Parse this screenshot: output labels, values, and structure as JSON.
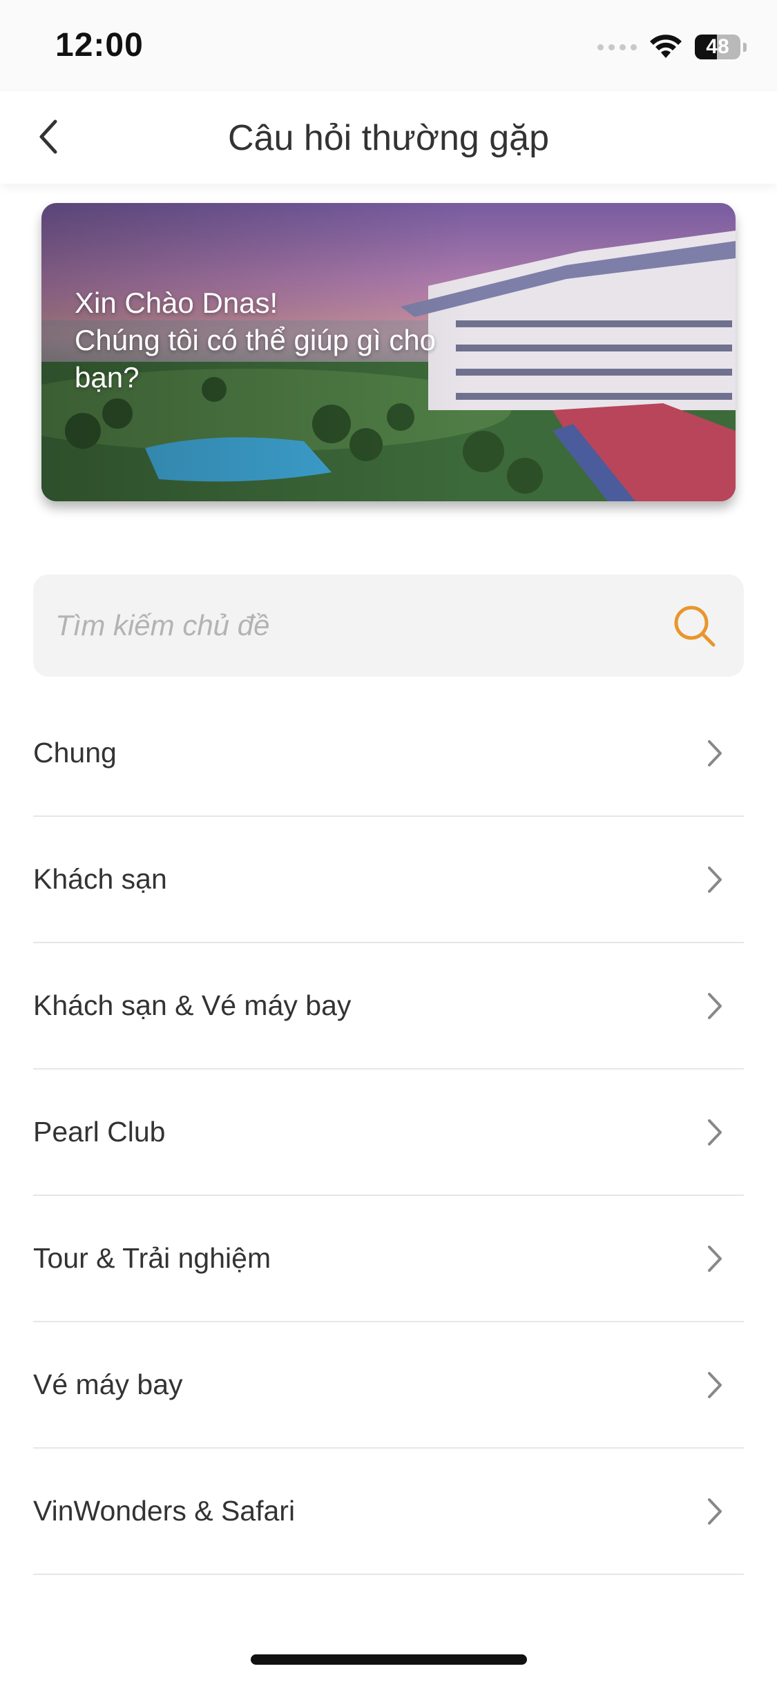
{
  "status_bar": {
    "time": "12:00",
    "battery_level": "48"
  },
  "header": {
    "title": "Câu hỏi thường gặp",
    "back_icon": "chevron-left-icon"
  },
  "banner": {
    "greeting_line1": "Xin Chào Dnas!",
    "greeting_line2": "Chúng tôi có thể giúp gì cho bạn?"
  },
  "search": {
    "placeholder": "Tìm kiếm chủ đề",
    "value": "",
    "icon": "search-icon",
    "icon_color": "#E8962C"
  },
  "faq_categories": [
    {
      "label": "Chung"
    },
    {
      "label": "Khách sạn"
    },
    {
      "label": "Khách sạn & Vé máy bay"
    },
    {
      "label": "Pearl Club"
    },
    {
      "label": "Tour & Trải nghiệm"
    },
    {
      "label": "Vé máy bay"
    },
    {
      "label": "VinWonders & Safari"
    }
  ],
  "colors": {
    "accent": "#E8962C",
    "text": "#333333",
    "divider": "#E6E6E6",
    "search_bg": "#F3F3F3"
  }
}
